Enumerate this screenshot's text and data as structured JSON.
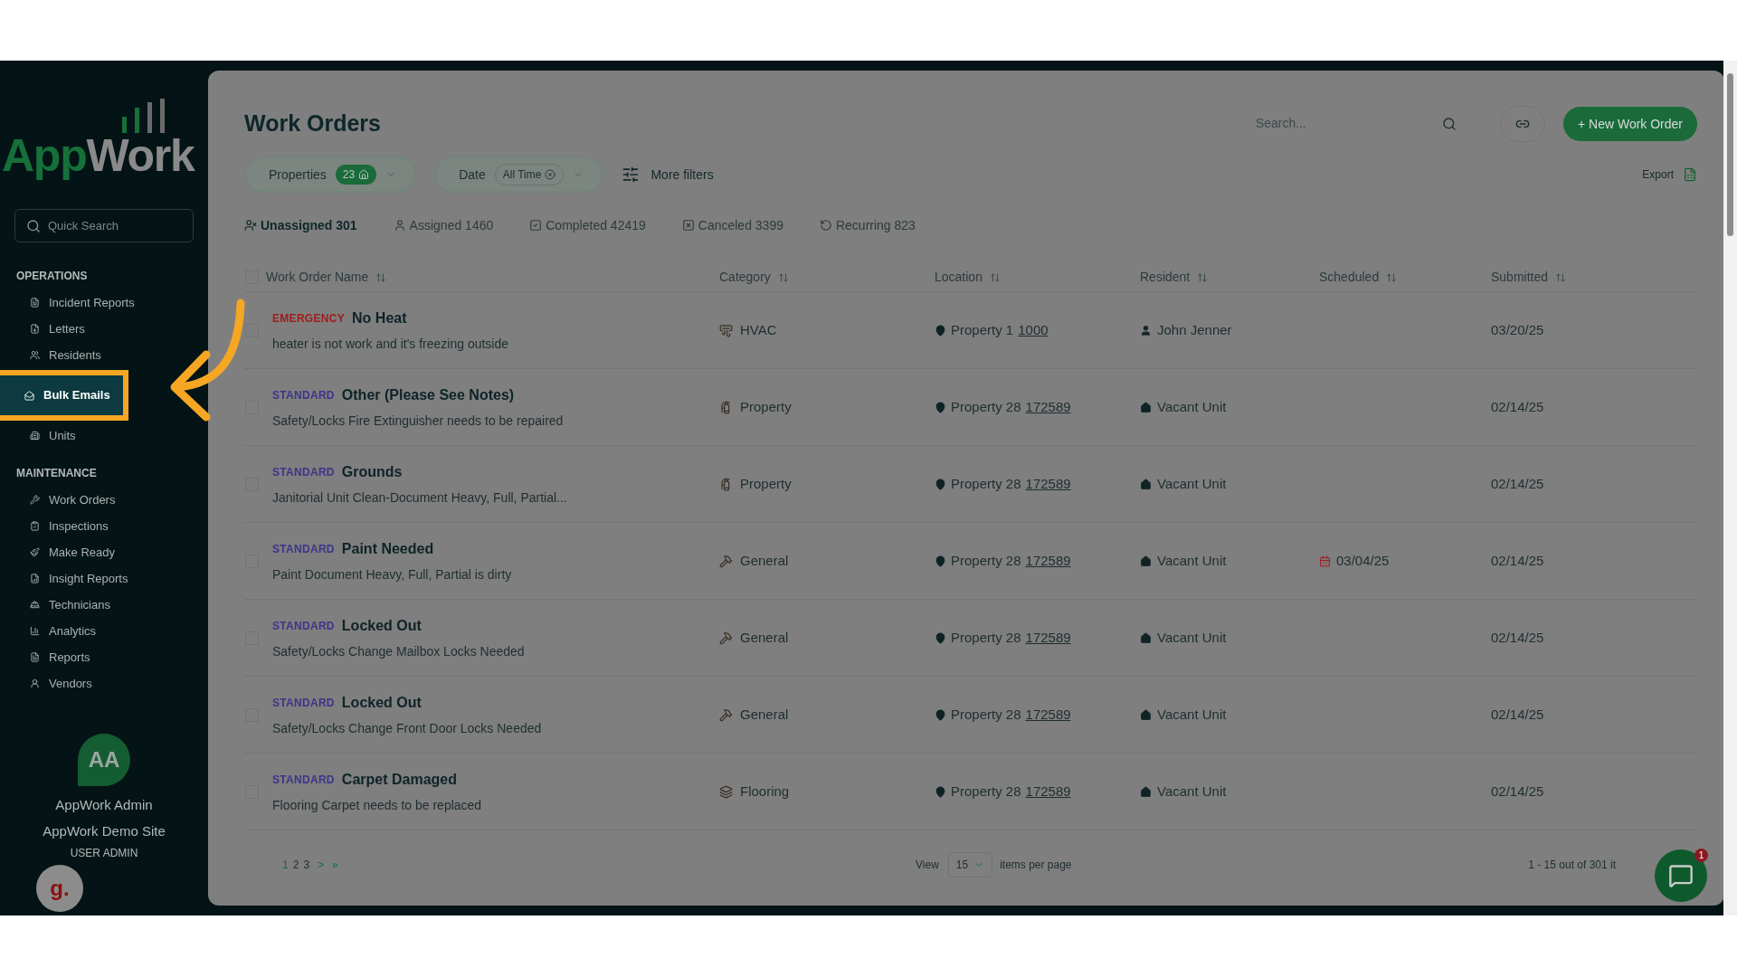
{
  "sidebar": {
    "logo": {
      "first": "App",
      "second": "Work"
    },
    "search": {
      "placeholder": "Quick Search"
    },
    "sections": [
      {
        "title": "OPERATIONS",
        "items": [
          {
            "label": "Incident Reports",
            "selected": false
          },
          {
            "label": "Letters",
            "selected": false
          },
          {
            "label": "Residents",
            "selected": false
          },
          {
            "label": "Bulk Emails",
            "selected": true
          },
          {
            "label": "Units",
            "selected": false
          }
        ]
      },
      {
        "title": "MAINTENANCE",
        "items": [
          {
            "label": "Work Orders",
            "selected": false
          },
          {
            "label": "Inspections",
            "selected": false
          },
          {
            "label": "Make Ready",
            "selected": false
          },
          {
            "label": "Insight Reports",
            "selected": false
          },
          {
            "label": "Technicians",
            "selected": false
          },
          {
            "label": "Analytics",
            "selected": false
          },
          {
            "label": "Reports",
            "selected": false
          },
          {
            "label": "Vendors",
            "selected": false
          }
        ]
      }
    ],
    "user": {
      "initials": "AA",
      "name": "AppWork Admin",
      "site": "AppWork Demo Site",
      "role": "USER ADMIN"
    },
    "helper": {
      "letter": "g."
    }
  },
  "header": {
    "title": "Work Orders",
    "search": {
      "placeholder": "Search..."
    },
    "new_button": "+ New Work Order"
  },
  "filters": {
    "properties": {
      "label": "Properties",
      "count": "23"
    },
    "date": {
      "label": "Date",
      "value": "All Time"
    },
    "more": "More filters",
    "export": "Export"
  },
  "tabs": [
    {
      "label": "Unassigned 301",
      "selected": true
    },
    {
      "label": "Assigned 1460",
      "selected": false
    },
    {
      "label": "Completed 42419",
      "selected": false
    },
    {
      "label": "Canceled 3399",
      "selected": false
    },
    {
      "label": "Recurring 823",
      "selected": false
    }
  ],
  "table": {
    "select_all_checked": false,
    "columns": [
      "Work Order Name",
      "Category",
      "Location",
      "Resident",
      "Scheduled",
      "Submitted"
    ],
    "rows": [
      {
        "priority": "EMERGENCY",
        "kind": "emergency",
        "title": "No Heat",
        "description": "heater is not work and it's freezing outside",
        "category": "HVAC",
        "location": "Property 1",
        "unit": "1000",
        "resident": "John Jenner",
        "submitted": "03/20/25",
        "checked": false
      },
      {
        "priority": "STANDARD",
        "kind": "standard",
        "title": "Other (Please See Notes)",
        "description": "Safety/Locks Fire Extinguisher needs to be repaired",
        "category": "Property",
        "location": "Property 28",
        "unit": "172589",
        "resident": "Vacant Unit",
        "submitted": "02/14/25",
        "checked": false
      },
      {
        "priority": "STANDARD",
        "kind": "standard",
        "title": "Grounds",
        "description": "Janitorial Unit Clean-Document Heavy, Full, Partial...",
        "category": "Property",
        "location": "Property 28",
        "unit": "172589",
        "resident": "Vacant Unit",
        "submitted": "02/14/25",
        "checked": false
      },
      {
        "priority": "STANDARD",
        "kind": "standard",
        "title": "Paint Needed",
        "description": "Paint Document Heavy, Full, Partial is dirty",
        "category": "General",
        "location": "Property 28",
        "unit": "172589",
        "resident": "Vacant Unit",
        "scheduled": "03/04/25",
        "submitted": "02/14/25",
        "checked": false
      },
      {
        "priority": "STANDARD",
        "kind": "standard",
        "title": "Locked Out",
        "description": "Safety/Locks Change Mailbox Locks Needed",
        "category": "General",
        "location": "Property 28",
        "unit": "172589",
        "resident": "Vacant Unit",
        "submitted": "02/14/25",
        "checked": false
      },
      {
        "priority": "STANDARD",
        "kind": "standard",
        "title": "Locked Out",
        "description": "Safety/Locks Change Front Door Locks Needed",
        "category": "General",
        "location": "Property 28",
        "unit": "172589",
        "resident": "Vacant Unit",
        "submitted": "02/14/25",
        "checked": false
      },
      {
        "priority": "STANDARD",
        "kind": "standard",
        "title": "Carpet Damaged",
        "description": "Flooring Carpet needs to be replaced",
        "category": "Flooring",
        "location": "Property 28",
        "unit": "172589",
        "resident": "Vacant Unit",
        "submitted": "02/14/25",
        "checked": false
      }
    ]
  },
  "pagination": {
    "pages": [
      {
        "label": "1",
        "selected": true
      },
      {
        "label": "2",
        "selected": false
      },
      {
        "label": "3",
        "selected": false
      }
    ],
    "next": ">",
    "last": "»",
    "view": "View",
    "per_page": "15",
    "per_page_suffix": "items per page",
    "range": "1 - 15 out of 301 it"
  },
  "chat": {
    "badge": "1"
  }
}
